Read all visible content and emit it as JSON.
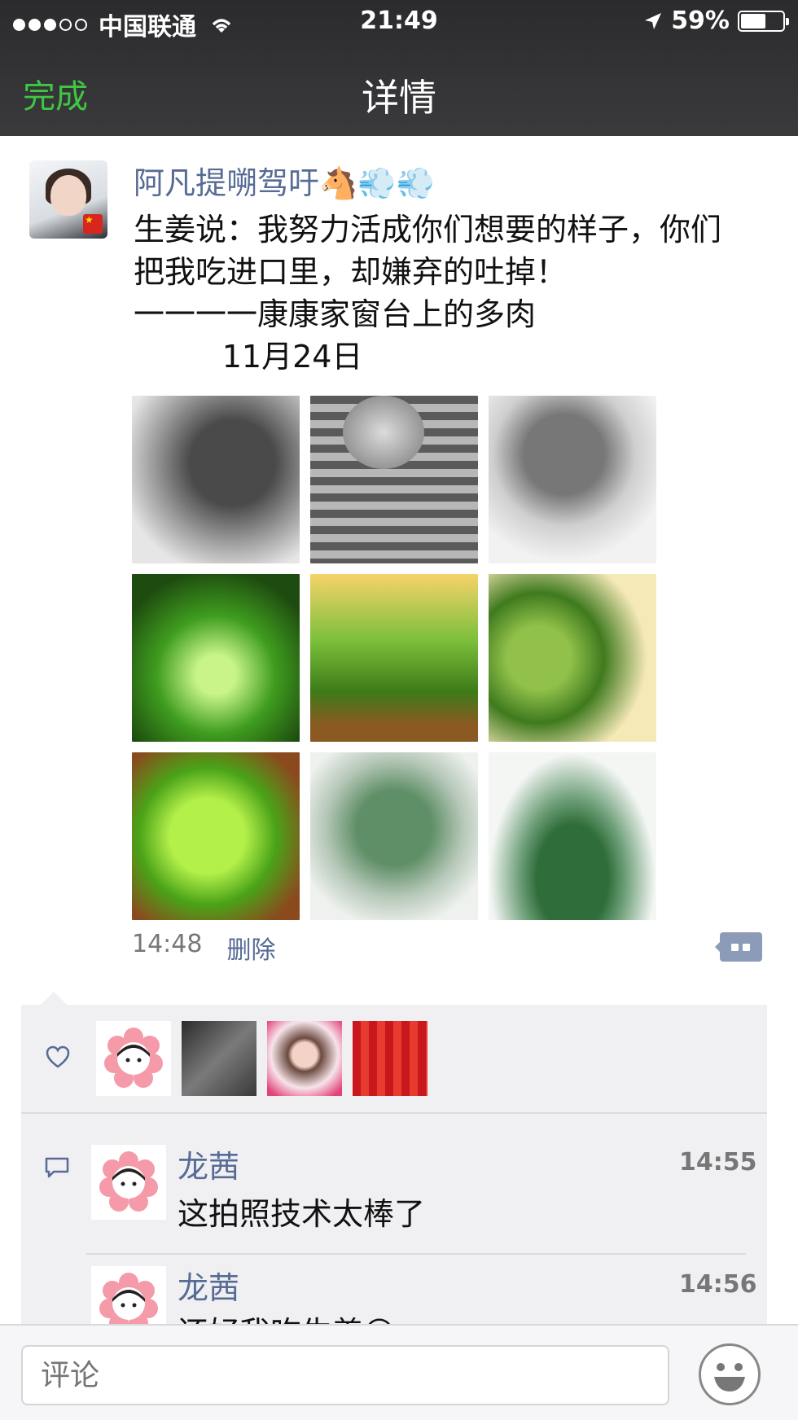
{
  "status_bar": {
    "carrier": "中国联通",
    "time": "21:49",
    "battery_percent": "59%",
    "battery_level": 0.59
  },
  "nav": {
    "done_label": "完成",
    "title": "详情"
  },
  "post": {
    "author": "阿凡提嗍驾吁🐴💨💨",
    "text": "生姜说：我努力活成你们想要的样子，你们\n把我吃进口里，却嫌弃的吐掉！\n一一一一康康家窗台上的多肉\n         11月24日",
    "time": "14:48",
    "delete_label": "删除",
    "photos": [
      "succulent-1",
      "succulent-2",
      "succulent-3",
      "succulent-4",
      "succulent-5",
      "succulent-6",
      "succulent-7",
      "succulent-8",
      "succulent-9"
    ]
  },
  "likes": {
    "icon": "heart-icon",
    "avatars": [
      "flower-avatar",
      "rock-avatar",
      "girl-avatar",
      "crowd-avatar"
    ]
  },
  "comments": [
    {
      "name": "龙茜",
      "time": "14:55",
      "text": "这拍照技术太棒了"
    },
    {
      "name": "龙茜",
      "time": "14:56",
      "text": "还好我吃生姜😊"
    }
  ],
  "input": {
    "placeholder": "评论"
  },
  "colors": {
    "link_blue": "#576b95",
    "done_green": "#3fc744",
    "header_bg": "#2b2b2d",
    "panel_bg": "#f0f0f3"
  }
}
